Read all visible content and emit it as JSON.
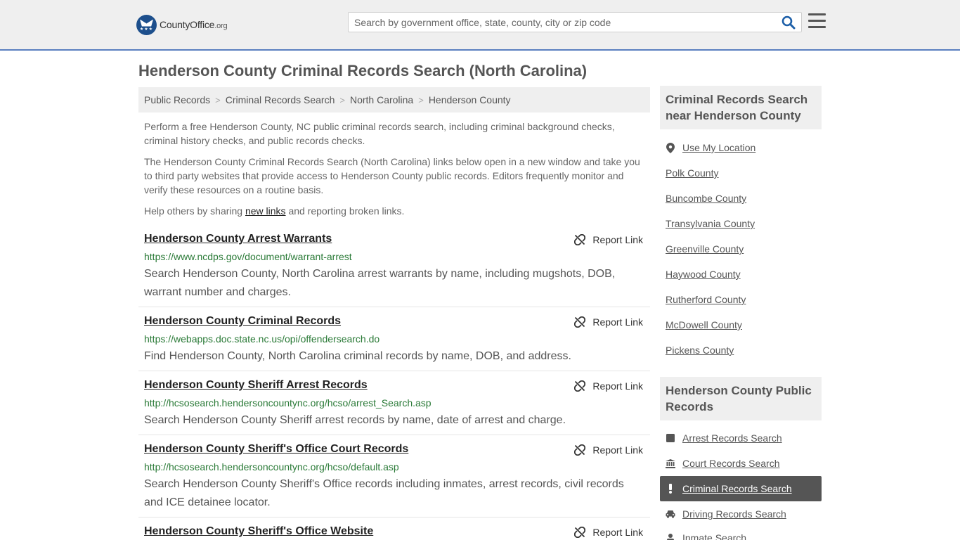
{
  "header": {
    "logo_main": "CountyOffice",
    "logo_tld": ".org",
    "search_placeholder": "Search by government office, state, county, city or zip code"
  },
  "page_title": "Henderson County Criminal Records Search (North Carolina)",
  "breadcrumb": [
    "Public Records",
    "Criminal Records Search",
    "North Carolina",
    "Henderson County"
  ],
  "intro": {
    "p1": "Perform a free Henderson County, NC public criminal records search, including criminal background checks, criminal history checks, and public records checks.",
    "p2": "The Henderson County Criminal Records Search (North Carolina) links below open in a new window and take you to third party websites that provide access to Henderson County public records. Editors frequently monitor and verify these resources on a routine basis.",
    "p3_before": "Help others by sharing ",
    "p3_link": "new links",
    "p3_after": " and reporting broken links."
  },
  "report_label": "Report Link",
  "listings": [
    {
      "title": "Henderson County Arrest Warrants",
      "url": "https://www.ncdps.gov/document/warrant-arrest",
      "desc": "Search Henderson County, North Carolina arrest warrants by name, including mugshots, DOB, warrant number and charges."
    },
    {
      "title": "Henderson County Criminal Records",
      "url": "https://webapps.doc.state.nc.us/opi/offendersearch.do",
      "desc": "Find Henderson County, North Carolina criminal records by name, DOB, and address."
    },
    {
      "title": "Henderson County Sheriff Arrest Records",
      "url": "http://hcsosearch.hendersoncountync.org/hcso/arrest_Search.asp",
      "desc": "Search Henderson County Sheriff arrest records by name, date of arrest and charge."
    },
    {
      "title": "Henderson County Sheriff's Office Court Records",
      "url": "http://hcsosearch.hendersoncountync.org/hcso/default.asp",
      "desc": "Search Henderson County Sheriff's Office records including inmates, arrest records, civil records and ICE detainee locator."
    },
    {
      "title": "Henderson County Sheriff's Office Website",
      "url": "",
      "desc": ""
    }
  ],
  "sidebar": {
    "nearby_heading": "Criminal Records Search near Henderson County",
    "use_location": "Use My Location",
    "nearby": [
      "Polk County",
      "Buncombe County",
      "Transylvania County",
      "Greenville County",
      "Haywood County",
      "Rutherford County",
      "McDowell County",
      "Pickens County"
    ],
    "public_heading": "Henderson County Public Records",
    "public_records": [
      {
        "label": "Arrest Records Search",
        "icon": "square-icon"
      },
      {
        "label": "Court Records Search",
        "icon": "courthouse-icon"
      },
      {
        "label": "Criminal Records Search",
        "icon": "exclamation-icon",
        "active": true
      },
      {
        "label": "Driving Records Search",
        "icon": "car-icon"
      },
      {
        "label": "Inmate Search",
        "icon": "inmate-icon"
      }
    ]
  },
  "colors": {
    "header_bg": "#efefef",
    "header_border": "#5a7fbf",
    "url_green": "#2a7a37",
    "logo_blue": "#1d4f8c",
    "search_icon": "#1d5fa8",
    "active_bg": "#555555"
  }
}
